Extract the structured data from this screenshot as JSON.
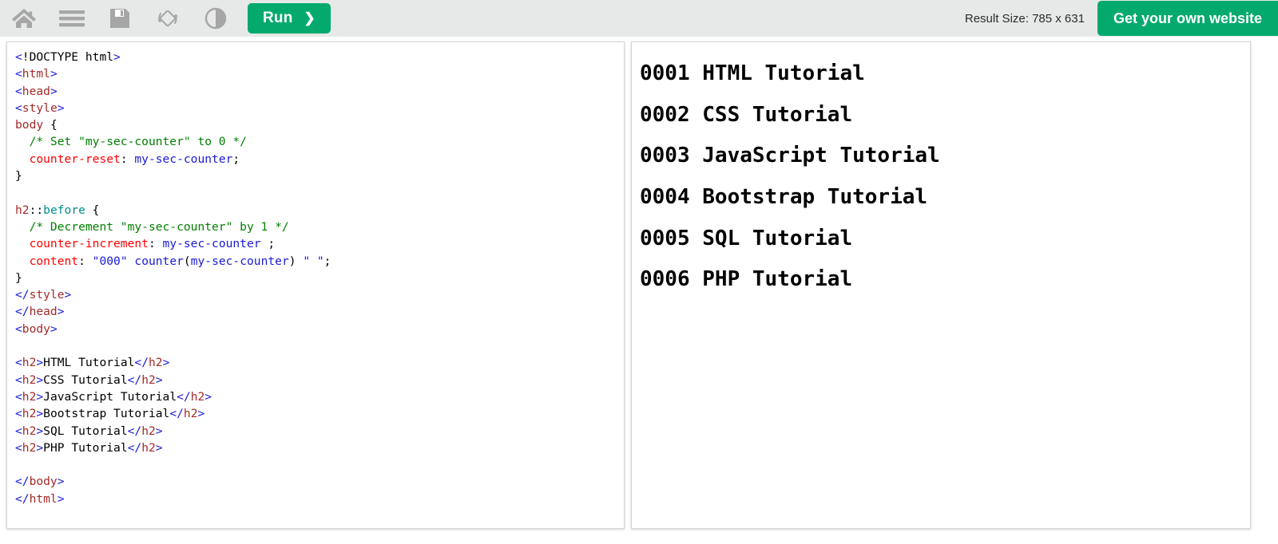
{
  "toolbar": {
    "icons": [
      {
        "name": "home-icon",
        "label": "Home"
      },
      {
        "name": "menu-icon",
        "label": "Menu"
      },
      {
        "name": "save-icon",
        "label": "Save"
      },
      {
        "name": "rotate-icon",
        "label": "Change Orientation"
      },
      {
        "name": "contrast-icon",
        "label": "Dark/Light Mode"
      }
    ],
    "run_label": "Run",
    "run_chevron": "❯",
    "result_size": "Result Size: 785 x 631",
    "get_website_label": "Get your own website",
    "accent_color": "#04aa6d",
    "bar_color": "#e7e9e8"
  },
  "editor": {
    "lines": [
      [
        {
          "t": "<",
          "c": "tag"
        },
        {
          "t": "!DOCTYPE html",
          "c": "punc"
        },
        {
          "t": ">",
          "c": "tag"
        }
      ],
      [
        {
          "t": "<",
          "c": "tag"
        },
        {
          "t": "html",
          "c": "tagname"
        },
        {
          "t": ">",
          "c": "tag"
        }
      ],
      [
        {
          "t": "<",
          "c": "tag"
        },
        {
          "t": "head",
          "c": "tagname"
        },
        {
          "t": ">",
          "c": "tag"
        }
      ],
      [
        {
          "t": "<",
          "c": "tag"
        },
        {
          "t": "style",
          "c": "tagname"
        },
        {
          "t": ">",
          "c": "tag"
        }
      ],
      [
        {
          "t": "body",
          "c": "sel"
        },
        {
          "t": " {",
          "c": "punc"
        }
      ],
      [
        {
          "t": "  ",
          "c": "punc"
        },
        {
          "t": "/* Set \"my-sec-counter\" to 0 */",
          "c": "cmt"
        }
      ],
      [
        {
          "t": "  ",
          "c": "punc"
        },
        {
          "t": "counter-reset",
          "c": "prop"
        },
        {
          "t": ": ",
          "c": "punc"
        },
        {
          "t": "my-sec-counter",
          "c": "val"
        },
        {
          "t": ";",
          "c": "punc"
        }
      ],
      [
        {
          "t": "}",
          "c": "punc"
        }
      ],
      [
        {
          "t": "",
          "c": "punc"
        }
      ],
      [
        {
          "t": "h2",
          "c": "sel"
        },
        {
          "t": "::",
          "c": "punc"
        },
        {
          "t": "before",
          "c": "pseudo"
        },
        {
          "t": " {",
          "c": "punc"
        }
      ],
      [
        {
          "t": "  ",
          "c": "punc"
        },
        {
          "t": "/* Decrement \"my-sec-counter\" by 1 */",
          "c": "cmt"
        }
      ],
      [
        {
          "t": "  ",
          "c": "punc"
        },
        {
          "t": "counter-increment",
          "c": "prop"
        },
        {
          "t": ": ",
          "c": "punc"
        },
        {
          "t": "my-sec-counter",
          "c": "val"
        },
        {
          "t": " ;",
          "c": "punc"
        }
      ],
      [
        {
          "t": "  ",
          "c": "punc"
        },
        {
          "t": "content",
          "c": "prop"
        },
        {
          "t": ": ",
          "c": "punc"
        },
        {
          "t": "\"000\"",
          "c": "val"
        },
        {
          "t": " ",
          "c": "punc"
        },
        {
          "t": "counter",
          "c": "val"
        },
        {
          "t": "(",
          "c": "punc"
        },
        {
          "t": "my-sec-counter",
          "c": "val"
        },
        {
          "t": ") ",
          "c": "punc"
        },
        {
          "t": "\" \"",
          "c": "val"
        },
        {
          "t": ";",
          "c": "punc"
        }
      ],
      [
        {
          "t": "}",
          "c": "punc"
        }
      ],
      [
        {
          "t": "</",
          "c": "tag"
        },
        {
          "t": "style",
          "c": "tagname"
        },
        {
          "t": ">",
          "c": "tag"
        }
      ],
      [
        {
          "t": "</",
          "c": "tag"
        },
        {
          "t": "head",
          "c": "tagname"
        },
        {
          "t": ">",
          "c": "tag"
        }
      ],
      [
        {
          "t": "<",
          "c": "tag"
        },
        {
          "t": "body",
          "c": "tagname"
        },
        {
          "t": ">",
          "c": "tag"
        }
      ],
      [
        {
          "t": "",
          "c": "punc"
        }
      ],
      [
        {
          "t": "<",
          "c": "tag"
        },
        {
          "t": "h2",
          "c": "tagname"
        },
        {
          "t": ">",
          "c": "tag"
        },
        {
          "t": "HTML Tutorial",
          "c": "punc"
        },
        {
          "t": "</",
          "c": "tag"
        },
        {
          "t": "h2",
          "c": "tagname"
        },
        {
          "t": ">",
          "c": "tag"
        }
      ],
      [
        {
          "t": "<",
          "c": "tag"
        },
        {
          "t": "h2",
          "c": "tagname"
        },
        {
          "t": ">",
          "c": "tag"
        },
        {
          "t": "CSS Tutorial",
          "c": "punc"
        },
        {
          "t": "</",
          "c": "tag"
        },
        {
          "t": "h2",
          "c": "tagname"
        },
        {
          "t": ">",
          "c": "tag"
        }
      ],
      [
        {
          "t": "<",
          "c": "tag"
        },
        {
          "t": "h2",
          "c": "tagname"
        },
        {
          "t": ">",
          "c": "tag"
        },
        {
          "t": "JavaScript Tutorial",
          "c": "punc"
        },
        {
          "t": "</",
          "c": "tag"
        },
        {
          "t": "h2",
          "c": "tagname"
        },
        {
          "t": ">",
          "c": "tag"
        }
      ],
      [
        {
          "t": "<",
          "c": "tag"
        },
        {
          "t": "h2",
          "c": "tagname"
        },
        {
          "t": ">",
          "c": "tag"
        },
        {
          "t": "Bootstrap Tutorial",
          "c": "punc"
        },
        {
          "t": "</",
          "c": "tag"
        },
        {
          "t": "h2",
          "c": "tagname"
        },
        {
          "t": ">",
          "c": "tag"
        }
      ],
      [
        {
          "t": "<",
          "c": "tag"
        },
        {
          "t": "h2",
          "c": "tagname"
        },
        {
          "t": ">",
          "c": "tag"
        },
        {
          "t": "SQL Tutorial",
          "c": "punc"
        },
        {
          "t": "</",
          "c": "tag"
        },
        {
          "t": "h2",
          "c": "tagname"
        },
        {
          "t": ">",
          "c": "tag"
        }
      ],
      [
        {
          "t": "<",
          "c": "tag"
        },
        {
          "t": "h2",
          "c": "tagname"
        },
        {
          "t": ">",
          "c": "tag"
        },
        {
          "t": "PHP Tutorial",
          "c": "punc"
        },
        {
          "t": "</",
          "c": "tag"
        },
        {
          "t": "h2",
          "c": "tagname"
        },
        {
          "t": ">",
          "c": "tag"
        }
      ],
      [
        {
          "t": "",
          "c": "punc"
        }
      ],
      [
        {
          "t": "</",
          "c": "tag"
        },
        {
          "t": "body",
          "c": "tagname"
        },
        {
          "t": ">",
          "c": "tag"
        }
      ],
      [
        {
          "t": "</",
          "c": "tag"
        },
        {
          "t": "html",
          "c": "tagname"
        },
        {
          "t": ">",
          "c": "tag"
        }
      ]
    ]
  },
  "result": {
    "headings": [
      "0001 HTML Tutorial",
      "0002 CSS Tutorial",
      "0003 JavaScript Tutorial",
      "0004 Bootstrap Tutorial",
      "0005 SQL Tutorial",
      "0006 PHP Tutorial"
    ]
  }
}
